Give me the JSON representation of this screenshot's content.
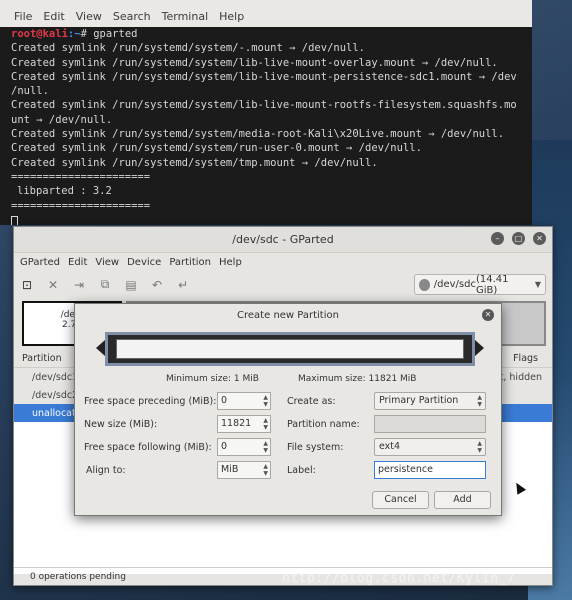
{
  "terminal": {
    "menu": [
      "File",
      "Edit",
      "View",
      "Search",
      "Terminal",
      "Help"
    ],
    "prompt_user": "root@kali",
    "prompt_path": ":~",
    "prompt_cmd": "# gparted",
    "lines": [
      "Created symlink /run/systemd/system/-.mount → /dev/null.",
      "Created symlink /run/systemd/system/lib-live-mount-overlay.mount → /dev/null.",
      "Created symlink /run/systemd/system/lib-live-mount-persistence-sdc1.mount → /dev",
      "/null.",
      "Created symlink /run/systemd/system/lib-live-mount-rootfs-filesystem.squashfs.mo",
      "unt → /dev/null.",
      "Created symlink /run/systemd/system/media-root-Kali\\x20Live.mount → /dev/null.",
      "Created symlink /run/systemd/system/run-user-0.mount → /dev/null.",
      "Created symlink /run/systemd/system/tmp.mount → /dev/null.",
      "======================",
      "libparted : 3.2",
      "======================"
    ]
  },
  "gparted": {
    "title": "/dev/sdc - GParted",
    "menu": [
      "GParted",
      "Edit",
      "View",
      "Device",
      "Partition",
      "Help"
    ],
    "device": "/dev/sdc",
    "device_size": "(14.41 GiB)",
    "graph_part_name": "/dev/",
    "graph_part_size": "2.76",
    "list_header_partition": "Partition",
    "list_header_flags": "Flags",
    "rows": [
      {
        "name": "/dev/sdc1",
        "flags": "boot, hidden"
      },
      {
        "name": "/dev/sdc2",
        "flags": ""
      },
      {
        "name": "unallocated",
        "flags": ""
      }
    ],
    "status": "0 operations pending"
  },
  "dialog": {
    "title": "Create new Partition",
    "min_size": "Minimum size: 1 MiB",
    "max_size": "Maximum size: 11821 MiB",
    "labels": {
      "free_preceding": "Free space preceding (MiB):",
      "new_size": "New size (MiB):",
      "free_following": "Free space following (MiB):",
      "align_to": "Align to:",
      "create_as": "Create as:",
      "partition_name": "Partition name:",
      "file_system": "File system:",
      "label": "Label:"
    },
    "values": {
      "free_preceding": "0",
      "new_size": "11821",
      "free_following": "0",
      "align_to": "MiB",
      "create_as": "Primary Partition",
      "partition_name": "",
      "file_system": "ext4",
      "label": "persistence"
    },
    "cancel": "Cancel",
    "add": "Add"
  },
  "watermark": "http://blog.csdn.net/Kylin_7"
}
